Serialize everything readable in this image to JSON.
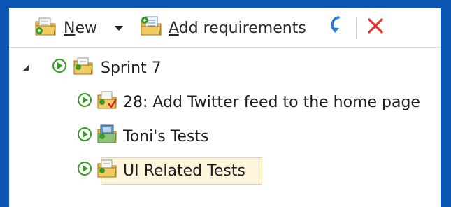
{
  "toolbar": {
    "new_label": "New",
    "new_mnemonic": "N",
    "new_rest": "ew",
    "add_req_label": "Add requirements",
    "add_req_mnemonic": "A",
    "add_req_rest": "dd requirements",
    "icons": {
      "new": "new-suite-folder-icon",
      "dropdown": "dropdown-arrow-icon",
      "add_requirements": "add-requirements-icon",
      "refresh": "refresh-arrow-icon",
      "delete": "delete-x-icon"
    }
  },
  "tree": {
    "root": {
      "label": "Sprint 7",
      "expanded": true
    },
    "children": [
      {
        "label": "28: Add Twitter feed to the home page",
        "type": "requirement-suite"
      },
      {
        "label": "Toni's Tests",
        "type": "query-suite"
      },
      {
        "label": "UI Related Tests",
        "type": "static-suite",
        "selected": true
      }
    ]
  },
  "colors": {
    "frame_blue": "#0c57b4",
    "run_green": "#3a9a2a",
    "delete_red": "#e03030",
    "refresh_blue": "#2f78d8",
    "selection_bg": "#fdf6dc",
    "selection_border": "#e3d39a"
  }
}
